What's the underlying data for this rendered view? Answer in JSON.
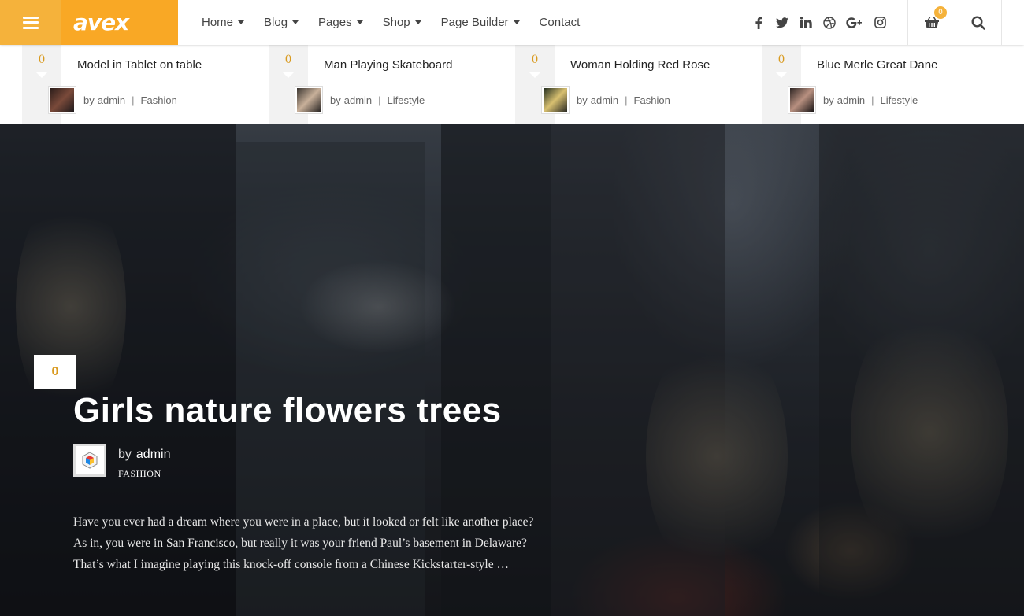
{
  "header": {
    "logo": "avex",
    "nav": [
      {
        "label": "Home",
        "dropdown": true
      },
      {
        "label": "Blog",
        "dropdown": true
      },
      {
        "label": "Pages",
        "dropdown": true
      },
      {
        "label": "Shop",
        "dropdown": true
      },
      {
        "label": "Page Builder",
        "dropdown": true
      },
      {
        "label": "Contact",
        "dropdown": false
      }
    ],
    "social_icons": [
      "facebook-icon",
      "twitter-icon",
      "linkedin-icon",
      "dribbble-icon",
      "google-plus-icon",
      "instagram-icon"
    ],
    "cart_count": "0",
    "accent_color": "#f5b23b"
  },
  "related": [
    {
      "count": "0",
      "title": "Model in Tablet on table",
      "by": "by",
      "author": "admin",
      "category": "Fashion"
    },
    {
      "count": "0",
      "title": "Man Playing Skateboard",
      "by": "by",
      "author": "admin",
      "category": "Lifestyle"
    },
    {
      "count": "0",
      "title": "Woman Holding Red Rose",
      "by": "by",
      "author": "admin",
      "category": "Fashion"
    },
    {
      "count": "0",
      "title": "Blue Merle Great Dane",
      "by": "by",
      "author": "admin",
      "category": "Lifestyle"
    }
  ],
  "featured": {
    "count": "0",
    "title": "Girls nature flowers trees",
    "by": "by",
    "author": "admin",
    "category": "FASHION",
    "excerpt": "Have you ever had a dream where you were in a place, but it looked or felt like another place? As in, you were in San Francisco, but really it was your friend Paul’s basement in Delaware? That’s what I imagine playing this knock-off console from a Chinese Kickstarter-style …"
  }
}
